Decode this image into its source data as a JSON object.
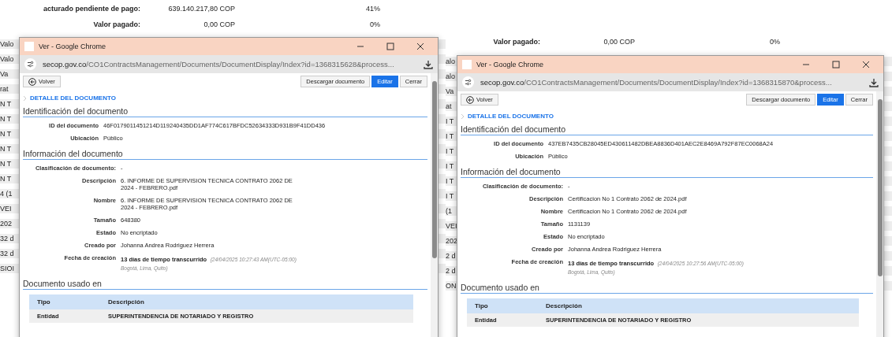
{
  "panels": [
    {
      "background_rows": [
        {
          "label": "acturado pendiente de pago:",
          "value": "639.140.217,80 COP",
          "percent": "41%"
        },
        {
          "label": "Valor pagado:",
          "value": "0,00 COP",
          "percent": "0%"
        }
      ],
      "edge_fragments": [
        "Valo",
        "Valo",
        "Va",
        "rat",
        "N T",
        "N T",
        "N T",
        "N T",
        "N T",
        "N T",
        "4 (1",
        "VEI",
        "202",
        "32 d",
        "32 d",
        "SIOI"
      ],
      "window": {
        "title": "Ver - Google Chrome",
        "url_domain": "secop.gov.co",
        "url_path": "/CO1ContractsManagement/Documents/DocumentDisplay/Index?id=1368315628&process...",
        "back_button": "Volver",
        "actions": [
          {
            "label": "Descargar documento",
            "primary": false
          },
          {
            "label": "Editar",
            "primary": true
          },
          {
            "label": "Cerrar",
            "primary": false
          }
        ],
        "breadcrumb": "DETALLE DEL DOCUMENTO",
        "sections": [
          {
            "heading": "Identificación del documento",
            "fields": [
              {
                "label": "ID del documento",
                "value": "46F0179011451214D119240435DD1AF774C617BFDC52634333D931B9F41DD436"
              },
              {
                "label": "Ubicación",
                "value": "Público"
              }
            ]
          },
          {
            "heading": "Información del documento",
            "fields": [
              {
                "label": "Clasificación de documento:",
                "value": "-"
              },
              {
                "label": "Descripción",
                "value": "6. INFORME DE SUPERVISION TECNICA CONTRATO 2062 DE 2024 - FEBRERO.pdf"
              },
              {
                "label": "Nombre",
                "value": "6. INFORME DE SUPERVISION TECNICA CONTRATO 2062 DE 2024 - FEBRERO.pdf"
              },
              {
                "label": "Tamaño",
                "value": "648380"
              },
              {
                "label": "Estado",
                "value": "No encriptado"
              },
              {
                "label": "Creado por",
                "value": "Johanna Andrea Rodriguez Herrera"
              },
              {
                "label": "Fecha de creación",
                "value": "13 días de tiempo transcurrido",
                "note": "(24/04/2025 10:27:43 AM(UTC-05:00) Bogotá, Lima, Quito)"
              }
            ]
          }
        ],
        "usage": {
          "heading": "Documento usado en",
          "columns": [
            "Tipo",
            "Descripción"
          ],
          "rows": [
            [
              "Entidad",
              "SUPERINTENDENCIA DE NOTARIADO Y REGISTRO"
            ]
          ]
        }
      }
    },
    {
      "background_rows": [
        {
          "label": "Valor pagado:",
          "value": "0,00 COP",
          "percent": "0%"
        }
      ],
      "edge_fragments": [
        "alo",
        "alo",
        "Va",
        "at",
        "I T",
        "I T",
        "I T",
        "I T",
        "I T",
        "I T",
        "(1",
        "VEI",
        "202",
        "2 d",
        "2 d",
        "ON"
      ],
      "window": {
        "title": "Ver - Google Chrome",
        "url_domain": "secop.gov.co",
        "url_path": "/CO1ContractsManagement/Documents/DocumentDisplay/Index?id=1368315870&process...",
        "back_button": "Volver",
        "actions": [
          {
            "label": "Descargar documento",
            "primary": false
          },
          {
            "label": "Editar",
            "primary": true
          },
          {
            "label": "Cerrar",
            "primary": false
          }
        ],
        "breadcrumb": "DETALLE DEL DOCUMENTO",
        "sections": [
          {
            "heading": "Identificación del documento",
            "fields": [
              {
                "label": "ID del documento",
                "value": "437EB7435CB28045ED430611482DBEA8836D401AEC2E8469A792F87EC0068A24"
              },
              {
                "label": "Ubicación",
                "value": "Público"
              }
            ]
          },
          {
            "heading": "Información del documento",
            "fields": [
              {
                "label": "Clasificación de documento:",
                "value": "-"
              },
              {
                "label": "Descripción",
                "value": "Certificacion No 1 Contrato 2062 de 2024.pdf"
              },
              {
                "label": "Nombre",
                "value": "Certificacion No 1 Contrato 2062 de 2024.pdf"
              },
              {
                "label": "Tamaño",
                "value": "1131139"
              },
              {
                "label": "Estado",
                "value": "No encriptado"
              },
              {
                "label": "Creado por",
                "value": "Johanna Andrea Rodriguez Herrera"
              },
              {
                "label": "Fecha de creación",
                "value": "13 días de tiempo transcurrido",
                "note": "(24/04/2025 10:27:56 AM(UTC-05:00) Bogotá, Lima, Quito)"
              }
            ]
          }
        ],
        "usage": {
          "heading": "Documento usado en",
          "columns": [
            "Tipo",
            "Descripción"
          ],
          "rows": [
            [
              "Entidad",
              "SUPERINTENDENCIA DE NOTARIADO Y REGISTRO"
            ]
          ]
        }
      }
    }
  ]
}
